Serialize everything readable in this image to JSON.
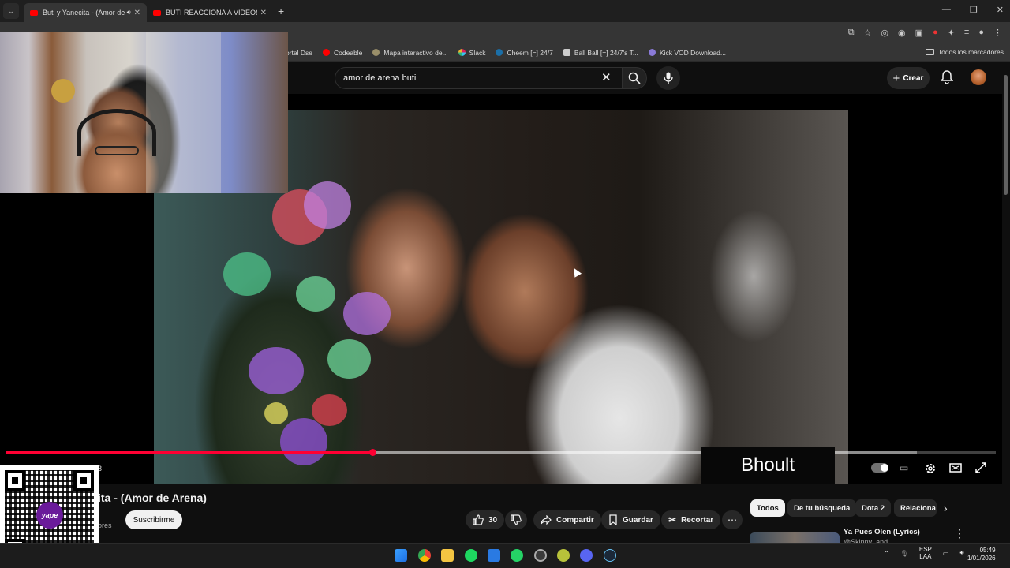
{
  "browser": {
    "tabs": [
      {
        "title": "Buti y Yanecita - (Amor de A",
        "active": true,
        "audio_icon": "speaker-icon"
      },
      {
        "title": "BUTI REACCIONA A VIDEOS AN",
        "active": false
      }
    ],
    "bookmarks": [
      {
        "label": "ortal Dse",
        "icon": "portal-icon"
      },
      {
        "label": "Codeable",
        "icon": "youtube-icon"
      },
      {
        "label": "Mapa interactivo de...",
        "icon": "map-icon"
      },
      {
        "label": "Slack",
        "icon": "slack-icon"
      },
      {
        "label": "Cheem [=] 24/7",
        "icon": "steam-icon"
      },
      {
        "label": "Ball Ball [=] 24/7's T...",
        "icon": "ball-icon"
      },
      {
        "label": "Kick VOD Download...",
        "icon": "kick-icon"
      }
    ],
    "all_bookmarks": "Todos los marcadores"
  },
  "youtube": {
    "search_value": "amor de arena buti",
    "create_label": "Crear",
    "video": {
      "progress": 0.37,
      "buffered": 0.92,
      "time_fragment": "8",
      "caption": "Bhoult"
    },
    "title_fragment": "ita - (Amor de Arena)",
    "subs_fragment": "ores",
    "subscribe_label": "Suscribirme",
    "likes": "30",
    "share_label": "Compartir",
    "save_label": "Guardar",
    "clip_label": "Recortar",
    "chips": [
      "Todos",
      "De tu búsqueda",
      "Dota 2",
      "Relaciona"
    ],
    "recommendation": {
      "title": "Ya Pues Olen (Lyrics)",
      "channel": "@Skinny_and"
    },
    "qr_brand": "yape"
  },
  "taskbar": {
    "lang_top": "ESP",
    "lang_bottom": "LAA",
    "time": "05:49",
    "date": "1/01/2026"
  },
  "colors": {
    "accent_red": "#ff0033",
    "bg": "#0f0f0f"
  }
}
